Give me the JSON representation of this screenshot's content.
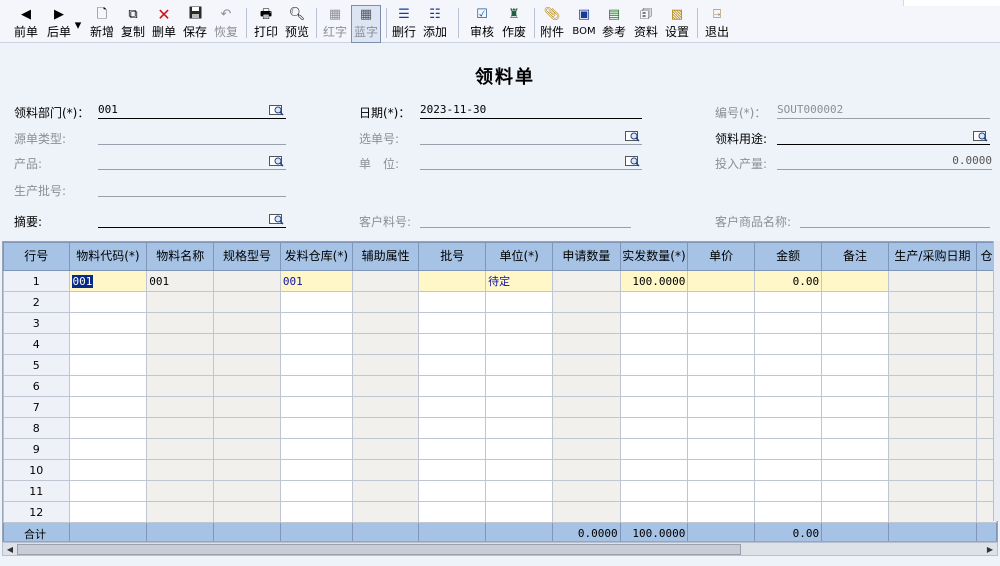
{
  "toolbar": {
    "prev": "前单",
    "next": "后单",
    "new": "新增",
    "copy": "复制",
    "delete": "删单",
    "save": "保存",
    "restore": "恢复",
    "print": "打印",
    "preview": "预览",
    "red": "红字",
    "blue": "蓝字",
    "delete_row": "删行",
    "add_row": "添加",
    "audit": "审核",
    "void": "作废",
    "attach": "附件",
    "bom": "BOM",
    "reference": "参考",
    "data": "资料",
    "settings": "设置",
    "exit": "退出"
  },
  "form": {
    "title": "领料单",
    "dept_label": "领料部门(*)：",
    "dept_value": "001",
    "date_label": "日期(*)：",
    "date_value": "2023-11-30",
    "no_label": "编号(*)：",
    "no_value": "SOUT000002",
    "src_type_label": "源单类型:",
    "select_no_label": "选单号:",
    "purpose_label": "领料用途:",
    "product_label": "产品:",
    "unit_label": "单　位:",
    "input_qty_label": "投入产量:",
    "input_qty_value": "0.0000",
    "batch_label": "生产批号:",
    "summary_label": "摘要:",
    "cust_code_label": "客户料号:",
    "cust_name_label": "客户商品名称:"
  },
  "grid": {
    "columns": [
      "行号",
      "物料代码(*)",
      "物料名称",
      "规格型号",
      "发料仓库(*)",
      "辅助属性",
      "批号",
      "单位(*)",
      "申请数量",
      "实发数量(*)",
      "单价",
      "金额",
      "备注",
      "生产/采购日期",
      "仓"
    ],
    "rows": [
      {
        "no": "1",
        "code": "001",
        "name": "001",
        "spec": "",
        "wh": "001",
        "aux": "",
        "batch": "",
        "unit": "待定",
        "apply": "",
        "actual": "100.0000",
        "price": "",
        "amount": "0.00",
        "note": "",
        "date": ""
      },
      {
        "no": "2"
      },
      {
        "no": "3"
      },
      {
        "no": "4"
      },
      {
        "no": "5"
      },
      {
        "no": "6"
      },
      {
        "no": "7"
      },
      {
        "no": "8"
      },
      {
        "no": "9"
      },
      {
        "no": "10"
      },
      {
        "no": "11"
      },
      {
        "no": "12"
      }
    ],
    "footer": {
      "label": "合计",
      "apply_total": "0.0000",
      "actual_total": "100.0000",
      "amount_total": "0.00"
    }
  },
  "colors": {
    "header_bg": "#a6c3e6",
    "active_row": "#fff7c8",
    "page_bg": "#eef2f9"
  }
}
